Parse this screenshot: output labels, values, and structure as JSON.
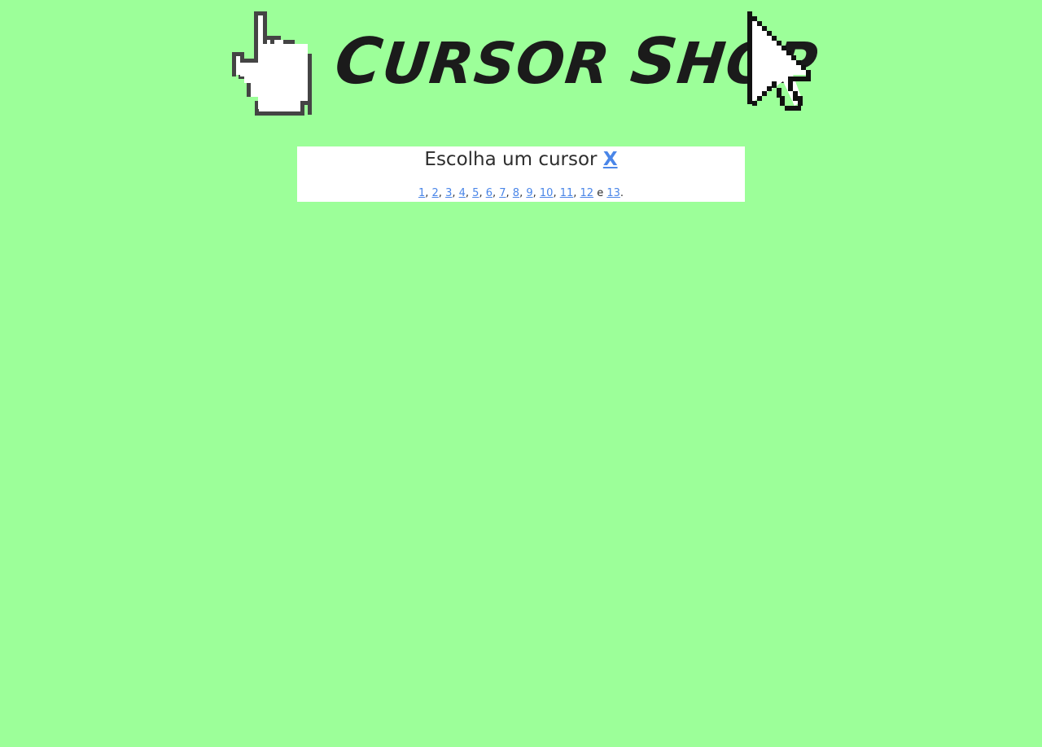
{
  "header": {
    "title_first": "C",
    "title_rest1": "URSOR ",
    "title_second": "S",
    "title_rest2": "HOP",
    "left_icon": "pointing-hand-icon",
    "right_icon": "arrow-pointer-icon"
  },
  "panel": {
    "heading": "Escolha um cursor",
    "close_label": "X",
    "links": [
      "1",
      "2",
      "3",
      "4",
      "5",
      "6",
      "7",
      "8",
      "9",
      "10",
      "11",
      "12",
      "13"
    ],
    "conjunction": "e",
    "end_punct": "."
  },
  "colors": {
    "background": "#9cff99",
    "panel": "#ffffff",
    "link": "#4a86e8",
    "text": "#2e2e2e",
    "title": "#1b1b1b"
  }
}
